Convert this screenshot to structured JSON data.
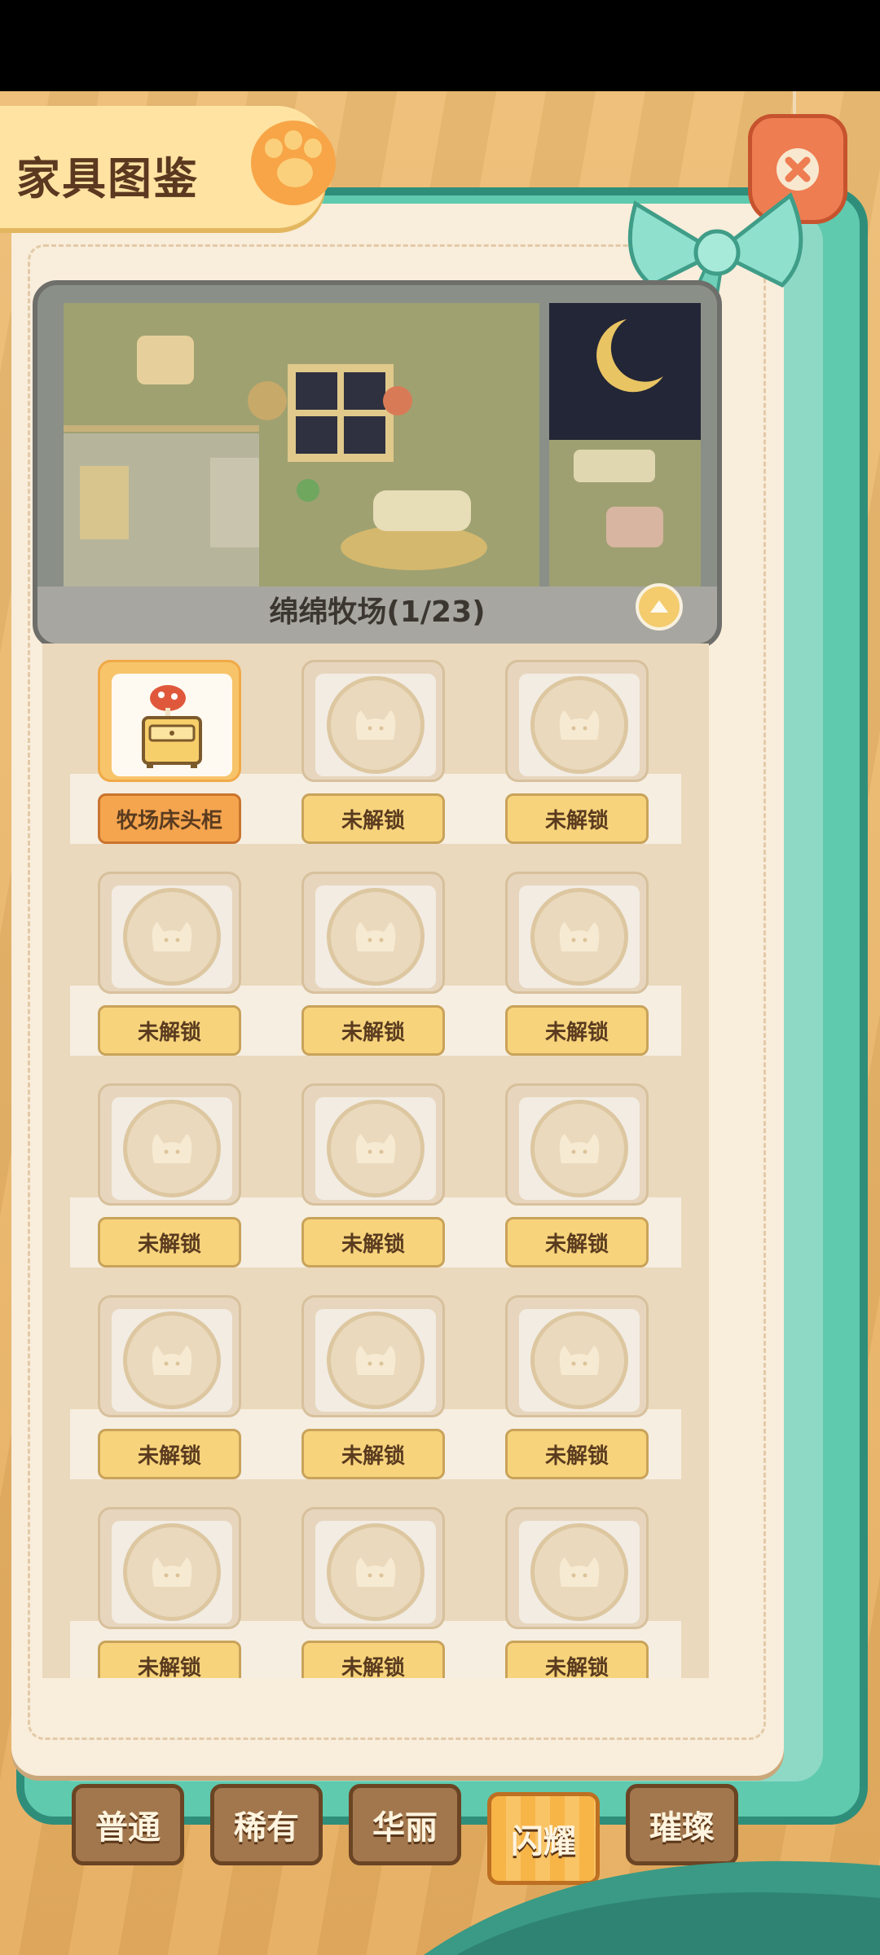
{
  "header": {
    "title": "家具图鉴",
    "close_icon": "close-icon"
  },
  "banner": {
    "set_name": "绵绵牧场(1/23)",
    "expand_icon": "chevron-up-icon"
  },
  "grid": {
    "items": [
      {
        "label": "牧场床头柜",
        "unlocked": true
      },
      {
        "label": "未解锁",
        "unlocked": false
      },
      {
        "label": "未解锁",
        "unlocked": false
      },
      {
        "label": "未解锁",
        "unlocked": false
      },
      {
        "label": "未解锁",
        "unlocked": false
      },
      {
        "label": "未解锁",
        "unlocked": false
      },
      {
        "label": "未解锁",
        "unlocked": false
      },
      {
        "label": "未解锁",
        "unlocked": false
      },
      {
        "label": "未解锁",
        "unlocked": false
      },
      {
        "label": "未解锁",
        "unlocked": false
      },
      {
        "label": "未解锁",
        "unlocked": false
      },
      {
        "label": "未解锁",
        "unlocked": false
      },
      {
        "label": "未解锁",
        "unlocked": false
      },
      {
        "label": "未解锁",
        "unlocked": false
      },
      {
        "label": "未解锁",
        "unlocked": false
      }
    ]
  },
  "tabs": [
    {
      "label": "普通",
      "active": false
    },
    {
      "label": "稀有",
      "active": false
    },
    {
      "label": "华丽",
      "active": false
    },
    {
      "label": "闪耀",
      "active": true
    },
    {
      "label": "璀璨",
      "active": false
    }
  ],
  "colors": {
    "accent": "#f7b447",
    "frame": "#5fcaae",
    "panel": "#f9eddb",
    "unlocked_label": "#f5a54e",
    "locked_label": "#f7d47c"
  }
}
